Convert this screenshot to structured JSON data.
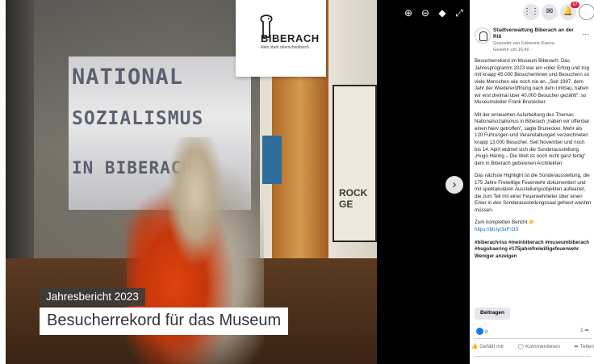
{
  "photo": {
    "banner_lines": [
      "NATIONAL",
      "SOZIALISMUS",
      "IN BIBERACH"
    ],
    "poster_text": "ROCK GE",
    "caption_year": "Jahresbericht 2023",
    "caption_title": "Besucherrekord für das Museum"
  },
  "logo": {
    "name": "BIBERACH",
    "claim": "klein.stark.oberschwäbisch."
  },
  "viewer_controls": {
    "zoom_in_icon": "zoom-in-icon",
    "zoom_out_icon": "zoom-out-icon",
    "tag_icon": "tag-icon",
    "fullscreen_icon": "fullscreen-icon",
    "next_icon": "chevron-right-icon"
  },
  "post": {
    "page_name": "Stadtverwaltung Biberach an der Riß",
    "meta_line1": "Gepostet von Fabienne Kanna",
    "meta_line2": "Gestern um 16:40 ·",
    "paragraphs": [
      "Besucherrekord im Museum Biberach: Das Jahresprogramm 2023 war ein voller Erfolg und zog mit knapp 45.000 Besucherinnen und Besuchern so viele Menschen wie noch nie an. „Seit 1997, dem Jahr der Wiedereröffnung nach dem Umbau, haben wir erst dreimal über 40.000 Besucher gezählt“, so Museumsleiter Frank Brunecker.",
      "Mit der erneuerten Aufarbeitung des Themas Nationalsozialismus in Biberach „haben wir offenbar einen Nerv getroffen“, sagte Brunecker. Mehr als 120 Führungen und Veranstaltungen verzeichneten knapp 13.000 Besucher. Seit November und noch bis 14. April widmet sich die Sonderausstellung „Hugo Häring – Die Welt ist noch nicht ganz fertig“ dem in Biberach geborenen Architekten.",
      "Das nächste Highlight ist die Sonderausstellung, die 175 Jahre Freiwillige Feuerwehr dokumentiert und mit spektakulären Ausstellungsobjekten aufwartet, die zum Teil mit einer Feuerwehrleiter über einen Erker in den Sonderausstellungssaal gehievt werden müssen."
    ],
    "report_label": "Zum kompletten Bericht 👉",
    "report_link": "https://bit.ly/3xFr2tS",
    "hashtags": "#biberachriss #meinbiberach #museumbiberach #hugohaering #175jahrefreiwilligefeuerwehr",
    "see_translation": "Weniger anzeigen",
    "translate_button": "Beitragen",
    "like_count": "8",
    "share_count": "1",
    "action_like": "Gefällt mir",
    "action_comment": "Kommentieren",
    "action_share": "Teilen"
  },
  "top_bar": {
    "notification_count": "67"
  }
}
